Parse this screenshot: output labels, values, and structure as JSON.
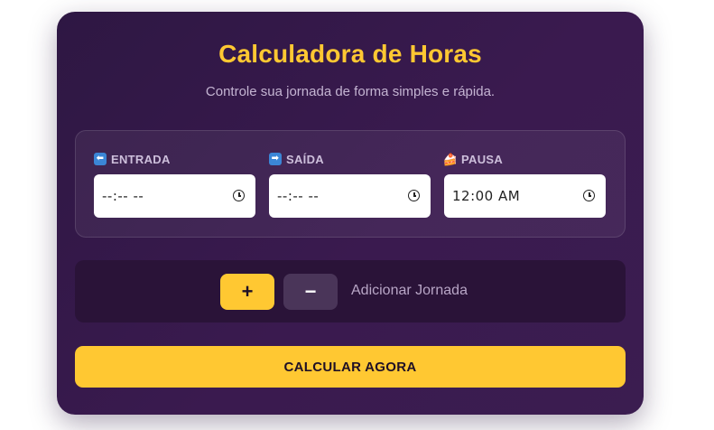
{
  "card": {
    "title": "Calculadora de Horas",
    "subtitle": "Controle sua jornada de forma simples e rápida."
  },
  "fields": [
    {
      "icon": "left-arrow-icon",
      "icon_glyph": "⬅",
      "label": "ENTRADA",
      "value": "--:-- --"
    },
    {
      "icon": "right-arrow-icon",
      "icon_glyph": "➡",
      "label": "SAÍDA",
      "value": "--:-- --"
    },
    {
      "icon": "cake-icon",
      "icon_glyph": "🍰",
      "label": "PAUSA",
      "value": "12:00 AM"
    }
  ],
  "jornada": {
    "plus_label": "+",
    "minus_label": "−",
    "label": "Adicionar Jornada"
  },
  "calculate_label": "CALCULAR AGORA",
  "colors": {
    "accent": "#ffc832",
    "card_bg": "#3a1a4f",
    "panel_dark": "#2a1338"
  }
}
